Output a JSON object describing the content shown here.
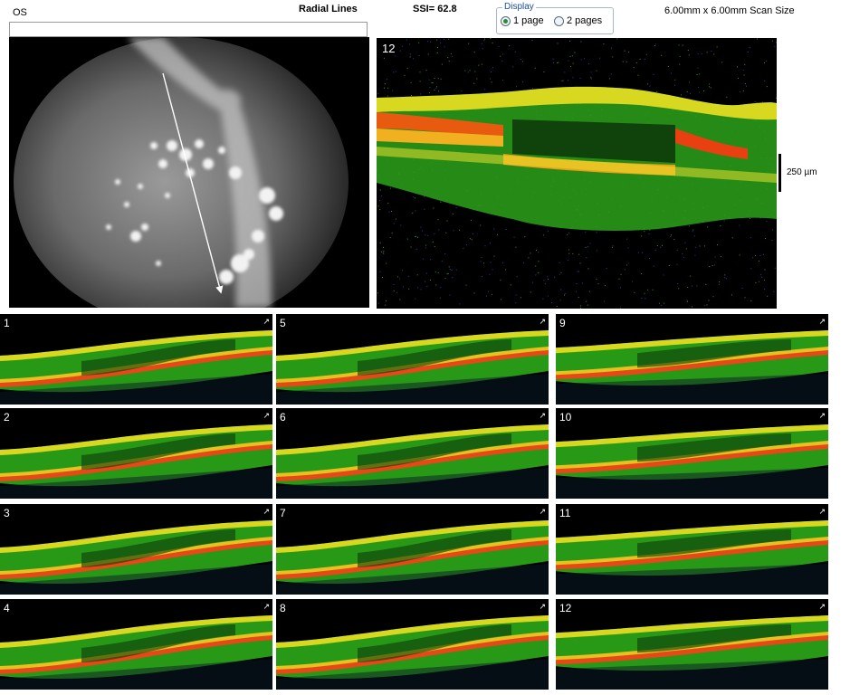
{
  "header": {
    "eye": "OS",
    "scan_mode": "Radial Lines",
    "ssi": "SSI= 62.8",
    "scan_size": "6.00mm x 6.00mm Scan Size"
  },
  "display": {
    "legend": "Display",
    "option_1": "1 page",
    "option_2": "2 pages",
    "selected": "1 page"
  },
  "main_scan": {
    "label": "12"
  },
  "scale": {
    "label": "250 µm"
  },
  "grid": {
    "cells": [
      {
        "label": "1"
      },
      {
        "label": "5"
      },
      {
        "label": "9"
      },
      {
        "label": "2"
      },
      {
        "label": "6"
      },
      {
        "label": "10"
      },
      {
        "label": "3"
      },
      {
        "label": "7"
      },
      {
        "label": "11"
      },
      {
        "label": "4"
      },
      {
        "label": "8"
      },
      {
        "label": "12"
      }
    ]
  },
  "colors": {
    "retina_red": "#e83010",
    "retina_orange": "#f0a010",
    "retina_yellow": "#e8e020",
    "retina_green": "#30c020"
  }
}
